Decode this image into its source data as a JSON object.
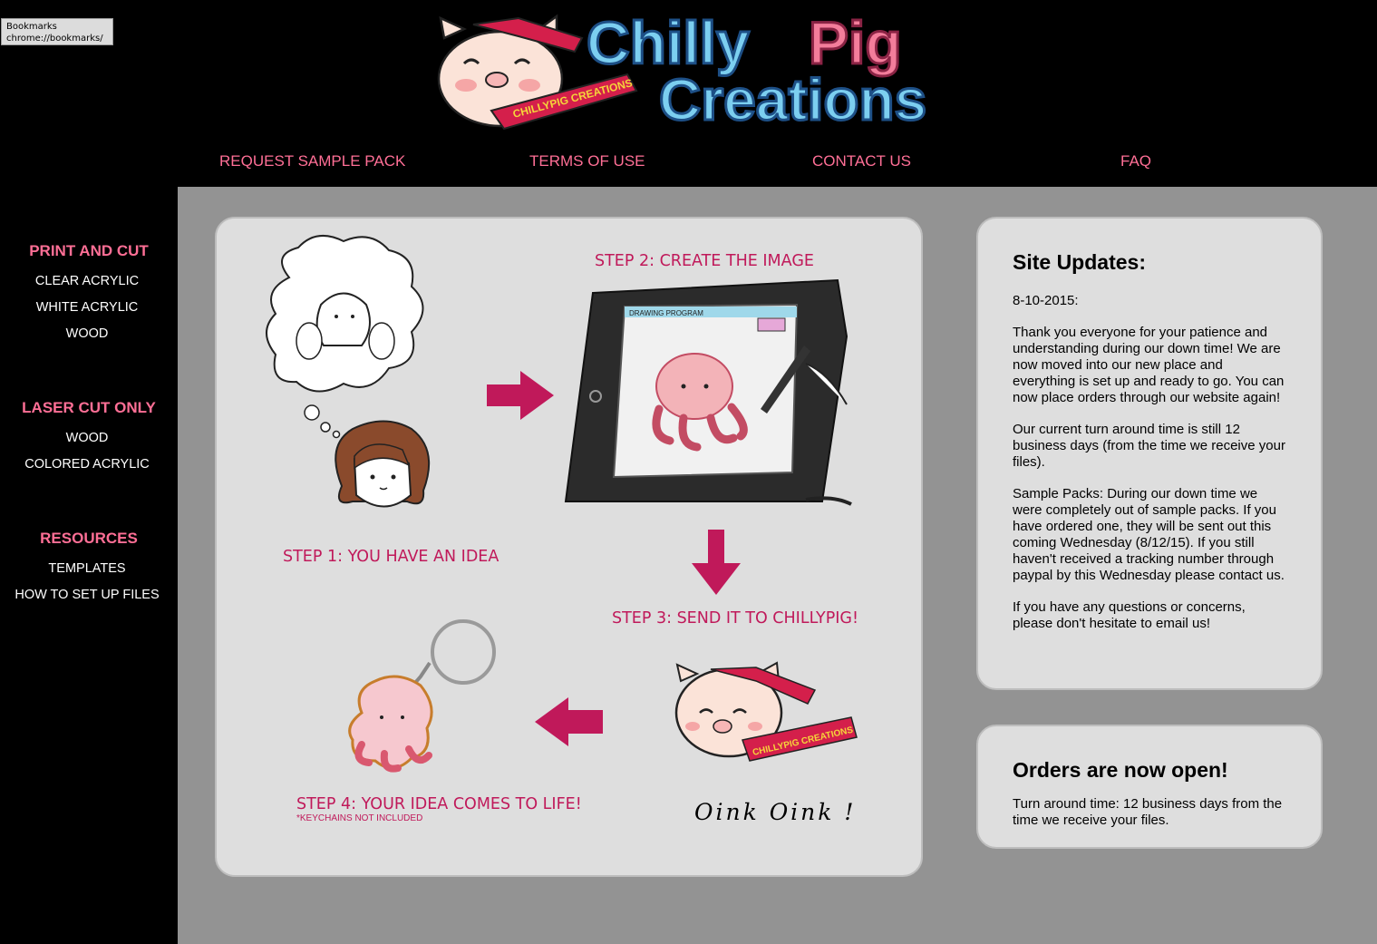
{
  "tooltip": {
    "line1": "Bookmarks",
    "line2": "chrome://bookmarks/"
  },
  "logo": {
    "word1": "Chilly",
    "word2": "Pig",
    "word3": "Creations",
    "banner": "CHILLYPIG CREATIONS"
  },
  "nav": [
    "REQUEST SAMPLE PACK",
    "TERMS OF USE",
    "CONTACT US",
    "FAQ"
  ],
  "sidebar": {
    "sections": [
      {
        "title": "PRINT AND CUT",
        "items": [
          "CLEAR ACRYLIC",
          "WHITE ACRYLIC",
          "WOOD"
        ]
      },
      {
        "title": "LASER CUT ONLY",
        "items": [
          "WOOD",
          "COLORED ACRYLIC"
        ]
      },
      {
        "title": "RESOURCES",
        "items": [
          "TEMPLATES",
          "HOW TO SET UP FILES"
        ]
      }
    ]
  },
  "steps": {
    "step1": "STEP 1: YOU HAVE AN IDEA",
    "step2": "STEP 2: CREATE THE IMAGE",
    "step3": "STEP 3: SEND IT TO CHILLYPIG!",
    "step4": "STEP 4: YOUR IDEA COMES TO LIFE!",
    "step4_note": "*KEYCHAINS NOT INCLUDED",
    "tablet_label": "DRAWING PROGRAM",
    "pig_banner": "CHILLYPIG CREATIONS",
    "oink": "Oink Oink !"
  },
  "updates": {
    "title": "Site Updates:",
    "date": "8-10-2015:",
    "p1": "Thank you everyone for your patience and understanding during our down time! We are now moved into our new place and everything is set up and ready to go. You can now place orders through our website again!",
    "p2": "Our current turn around time is still 12 business days (from the time we receive your files).",
    "p3": "Sample Packs: During our down time we were completely out of sample packs. If you have ordered one, they will be sent out this coming Wednesday (8/12/15). If you still haven't received a tracking number through paypal by this Wednesday please contact us.",
    "p4": "If you have any questions or concerns, please don't hesitate to email us!"
  },
  "orders": {
    "title": "Orders are now open!",
    "text": "Turn around time: 12 business days from the time we receive your files."
  },
  "colors": {
    "accent": "#ff6f96",
    "step": "#c0195a",
    "logo_blue": "#7ccff0",
    "logo_pink": "#f37d9b"
  }
}
